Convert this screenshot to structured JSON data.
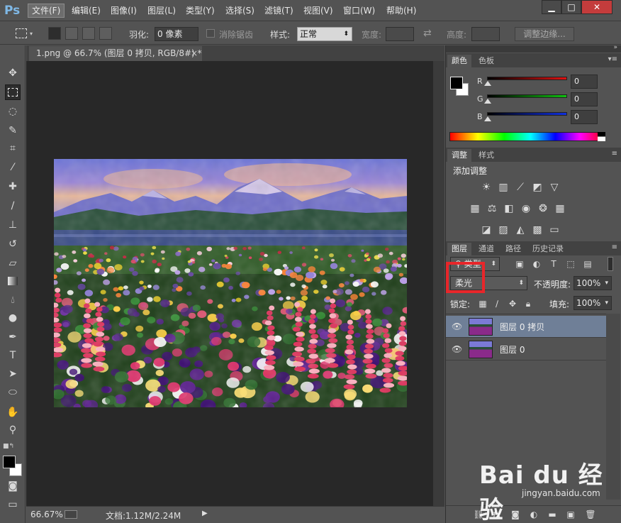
{
  "app": {
    "logo": "Ps"
  },
  "menu": [
    "文件(F)",
    "编辑(E)",
    "图像(I)",
    "图层(L)",
    "类型(Y)",
    "选择(S)",
    "滤镜(T)",
    "视图(V)",
    "窗口(W)",
    "帮助(H)"
  ],
  "window_controls": {
    "minimize": "▁",
    "restore": "□",
    "close": "✕"
  },
  "options": {
    "feather_label": "羽化:",
    "feather_value": "0 像素",
    "antialias_label": "消除锯齿",
    "style_label": "样式:",
    "style_value": "正常",
    "width_label": "宽度:",
    "height_label": "高度:",
    "refine_edge": "调整边缘..."
  },
  "document": {
    "tab_title": "1.png @ 66.7% (图层 0 拷贝, RGB/8#) *",
    "tab_close": "×",
    "zoom": "66.67%",
    "doc_size": "文档:1.12M/2.24M"
  },
  "color_panel": {
    "tabs": [
      "颜色",
      "色板"
    ],
    "channels": [
      {
        "label": "R",
        "value": "0",
        "color": "#e01010"
      },
      {
        "label": "G",
        "value": "0",
        "color": "#10c010"
      },
      {
        "label": "B",
        "value": "0",
        "color": "#1030e0"
      }
    ],
    "foreground": "#000000",
    "background": "#ffffff"
  },
  "adjustments_panel": {
    "tabs": [
      "调整",
      "样式"
    ],
    "title": "添加调整",
    "icons": [
      [
        "brightness-icon",
        "levels-icon",
        "curves-icon",
        "exposure-icon",
        "vibrance-icon"
      ],
      [
        "hue-saturation-icon",
        "color-balance-icon",
        "black-white-icon",
        "photo-filter-icon",
        "channel-mixer-icon",
        "color-lookup-icon"
      ],
      [
        "invert-icon",
        "posterize-icon",
        "threshold-icon",
        "selective-color-icon",
        "gradient-map-icon"
      ]
    ]
  },
  "layers_panel": {
    "tabs": [
      "图层",
      "通道",
      "路径",
      "历史记录"
    ],
    "filter_kind": "类型",
    "blend_mode": "柔光",
    "opacity_label": "不透明度:",
    "opacity_value": "100%",
    "lock_label": "锁定:",
    "fill_label": "填充:",
    "fill_value": "100%",
    "layers": [
      {
        "name": "图层 0 拷贝",
        "selected": true
      },
      {
        "name": "图层 0",
        "selected": false
      }
    ],
    "highlight_color": "#e8262a"
  },
  "watermark": {
    "brand": "Bai du 经验",
    "url": "jingyan.baidu.com"
  }
}
